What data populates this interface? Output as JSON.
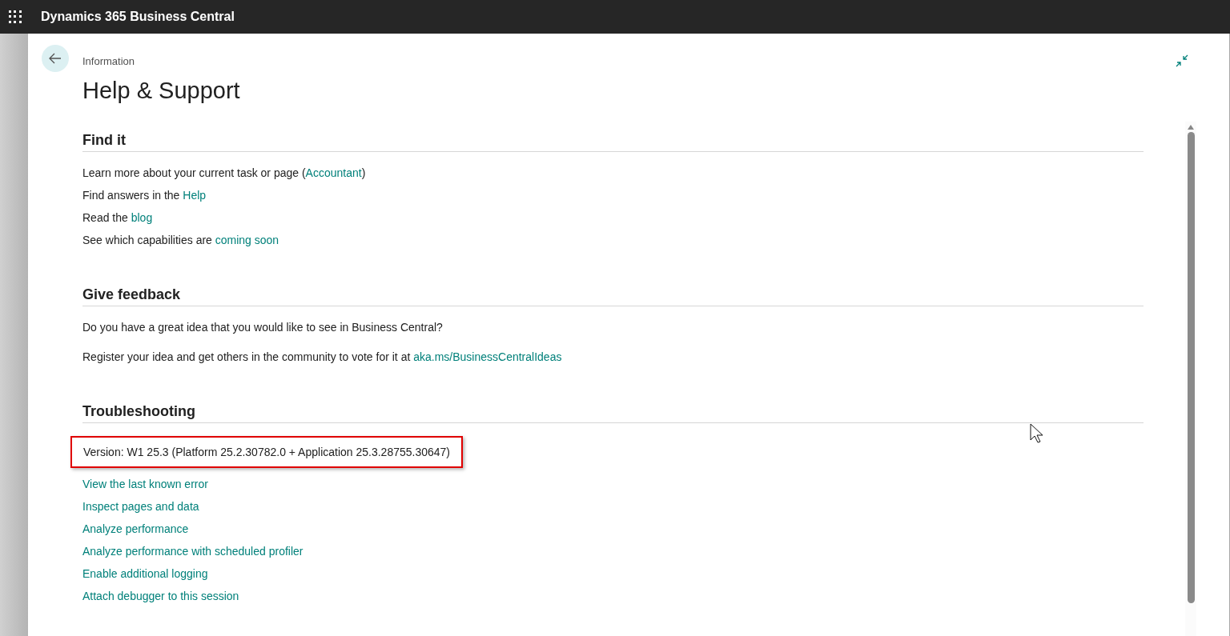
{
  "app_bar": {
    "title": "Dynamics 365 Business Central"
  },
  "page": {
    "caption": "Information",
    "title": "Help & Support"
  },
  "sections": [
    {
      "title": "Find it",
      "lines": [
        {
          "text": "Learn more about your current task or page (",
          "link": "Accountant",
          "after": ")"
        },
        {
          "text": "Find answers in the ",
          "link": "Help"
        },
        {
          "text": "Read the ",
          "link": "blog"
        },
        {
          "text": "See which capabilities are ",
          "link": "coming soon"
        }
      ]
    },
    {
      "title": "Give feedback",
      "lines": [
        {
          "text": "Do you have a great idea that you would like to see in Business Central?"
        },
        {
          "text": "Register your idea and get others in the community to vote for it at ",
          "link": "aka.ms/BusinessCentralIdeas"
        }
      ]
    },
    {
      "title": "Troubleshooting",
      "version": {
        "text": "Version: W1 25.3 (Platform 25.2.30782.0 + Application 25.3.28755.30647)",
        "highlighted": true
      },
      "links": [
        "View the last known error",
        "Inspect pages and data",
        "Analyze performance",
        "Analyze performance with scheduled profiler",
        "Enable additional logging",
        "Attach debugger to this session"
      ]
    }
  ]
}
